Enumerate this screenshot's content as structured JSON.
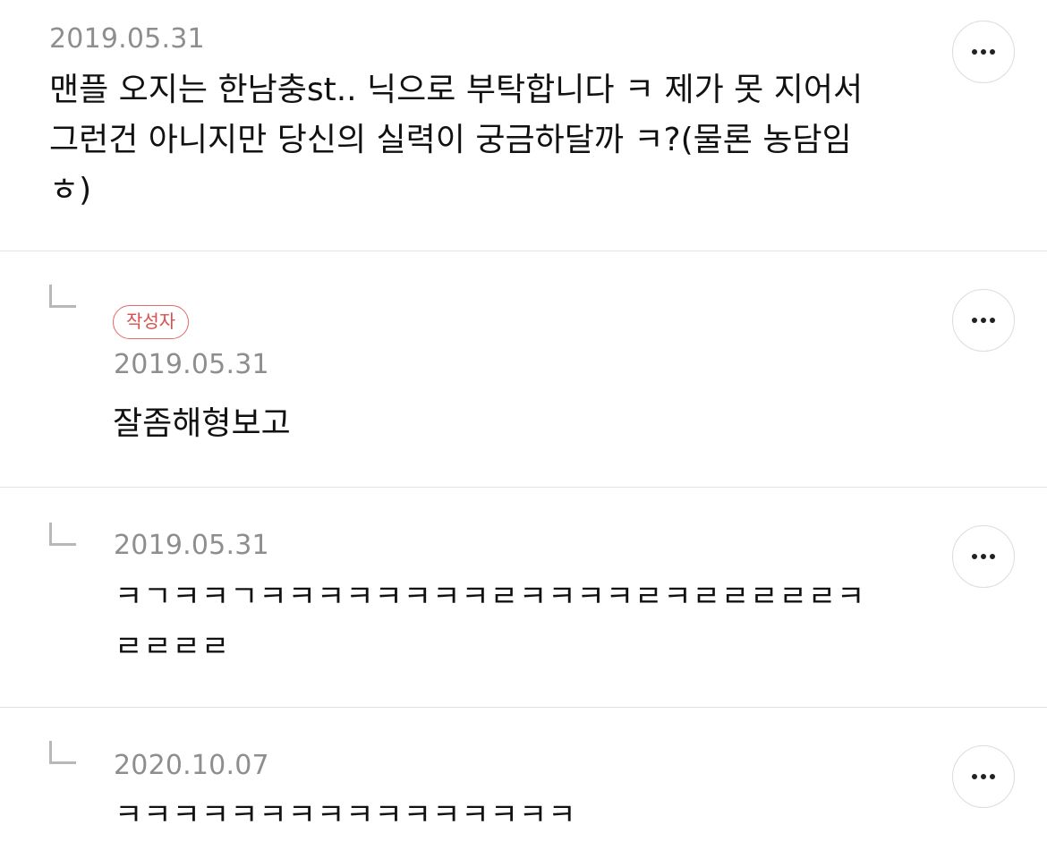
{
  "comments": [
    {
      "date": "2019.05.31",
      "text": "맨플 오지는 한남충st.. 닉으로 부탁합니다 ㅋ 제가 못 지어서\n그런건 아니지만 당신의 실력이 궁금하달까 ㅋ?(물론 농담임\nㅎ)",
      "is_reply": false,
      "more_icon": "more-horizontal-icon"
    },
    {
      "date": "2019.05.31",
      "badge": "작성자",
      "text": "잘좀해형보고",
      "is_reply": true,
      "reply_icon": "reply-arrow-icon",
      "more_icon": "more-horizontal-icon"
    },
    {
      "date": "2019.05.31",
      "text": "ㅋㄱㅋㅋㄱㅋㅋㅋㅋㅋㅋㅋㅋㄹㅋㅋㅋㅋㄹㅋㄹㄹㄹㄹㄹㅋ\nㄹㄹㄹㄹ",
      "is_reply": true,
      "reply_icon": "reply-arrow-icon",
      "more_icon": "more-horizontal-icon"
    },
    {
      "date": "2020.10.07",
      "text": "ㅋㅋㅋㅋㅋㅋㅋㅋㅋㅋㅋㅋㅋㅋㅋㅋ",
      "is_reply": true,
      "reply_icon": "reply-arrow-icon",
      "more_icon": "more-horizontal-icon"
    }
  ],
  "colors": {
    "divider": "#e3e3e3",
    "date": "#8e8e8e",
    "badge": "#d94f4f",
    "text": "#111111"
  }
}
